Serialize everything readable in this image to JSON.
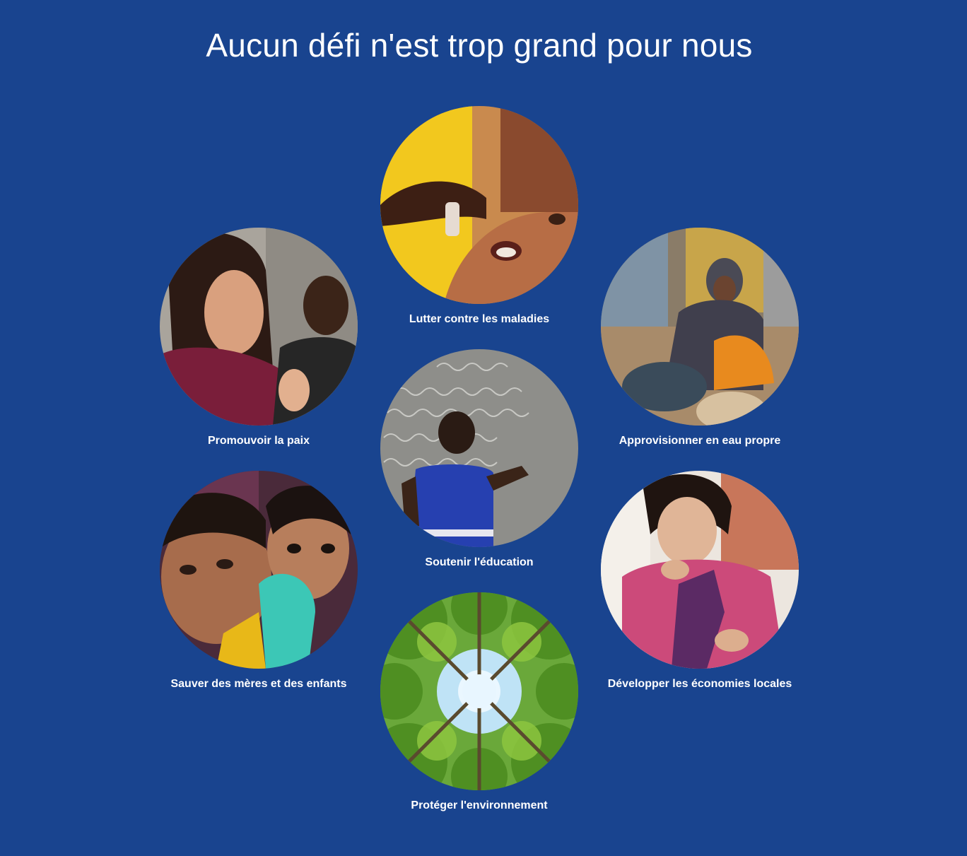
{
  "heading": "Aucun défi n'est trop grand pour nous",
  "colors": {
    "background": "#19448f",
    "text": "#ffffff"
  },
  "causes": [
    {
      "label": "Lutter contre les maladies",
      "image": "child-receiving-oral-vaccine"
    },
    {
      "label": "Promouvoir la paix",
      "image": "woman-speaking-at-meeting"
    },
    {
      "label": "Approvisionner en eau propre",
      "image": "woman-washing-in-basin"
    },
    {
      "label": "Soutenir l'éducation",
      "image": "girl-writing-on-chalkboard"
    },
    {
      "label": "Sauver des mères et des enfants",
      "image": "mother-and-child"
    },
    {
      "label": "Développer les économies locales",
      "image": "woman-sewing-fabric"
    },
    {
      "label": "Protéger l'environnement",
      "image": "forest-canopy-from-below"
    }
  ]
}
